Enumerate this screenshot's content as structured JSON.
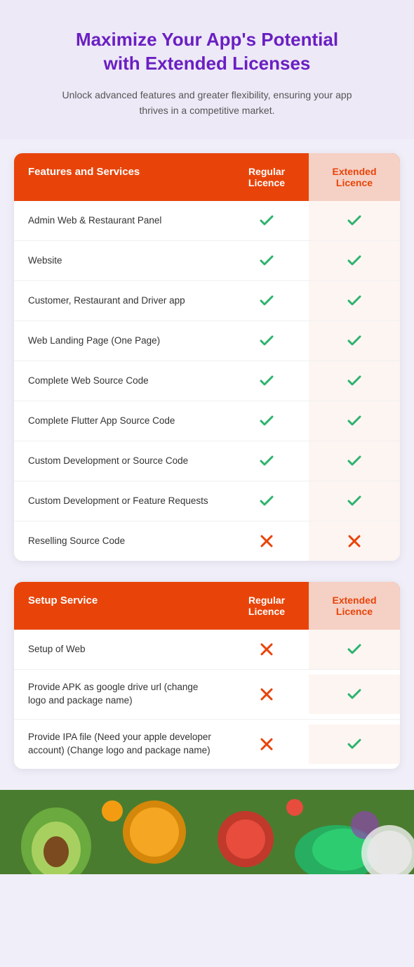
{
  "hero": {
    "title": "Maximize Your App's Potential\nwith Extended Licenses",
    "subtitle": "Unlock advanced features and greater flexibility, ensuring your app thrives in a competitive market."
  },
  "table1": {
    "header": {
      "col1": "Features and Services",
      "col2": "Regular Licence",
      "col3": "Extended Licence"
    },
    "rows": [
      {
        "label": "Admin Web & Restaurant Panel",
        "regular": "check",
        "extended": "check"
      },
      {
        "label": "Website",
        "regular": "check",
        "extended": "check"
      },
      {
        "label": "Customer, Restaurant and Driver app",
        "regular": "check",
        "extended": "check"
      },
      {
        "label": "Web Landing Page (One Page)",
        "regular": "check",
        "extended": "check"
      },
      {
        "label": "Complete Web Source Code",
        "regular": "check",
        "extended": "check"
      },
      {
        "label": "Complete Flutter App Source Code",
        "regular": "check",
        "extended": "check"
      },
      {
        "label": "Custom Development or Source Code",
        "regular": "check",
        "extended": "check"
      },
      {
        "label": "Custom Development or Feature Requests",
        "regular": "check",
        "extended": "check"
      },
      {
        "label": "Reselling Source Code",
        "regular": "cross",
        "extended": "cross"
      }
    ]
  },
  "table2": {
    "header": {
      "col1": "Setup Service",
      "col2": "Regular Licence",
      "col3": "Extended Licence"
    },
    "rows": [
      {
        "label": "Setup of Web",
        "regular": "cross",
        "extended": "check"
      },
      {
        "label": "Provide APK as google drive url (change logo and package name)",
        "regular": "cross",
        "extended": "check"
      },
      {
        "label": "Provide IPA file (Need your apple developer account) (Change logo and package name)",
        "regular": "cross",
        "extended": "check"
      }
    ]
  }
}
